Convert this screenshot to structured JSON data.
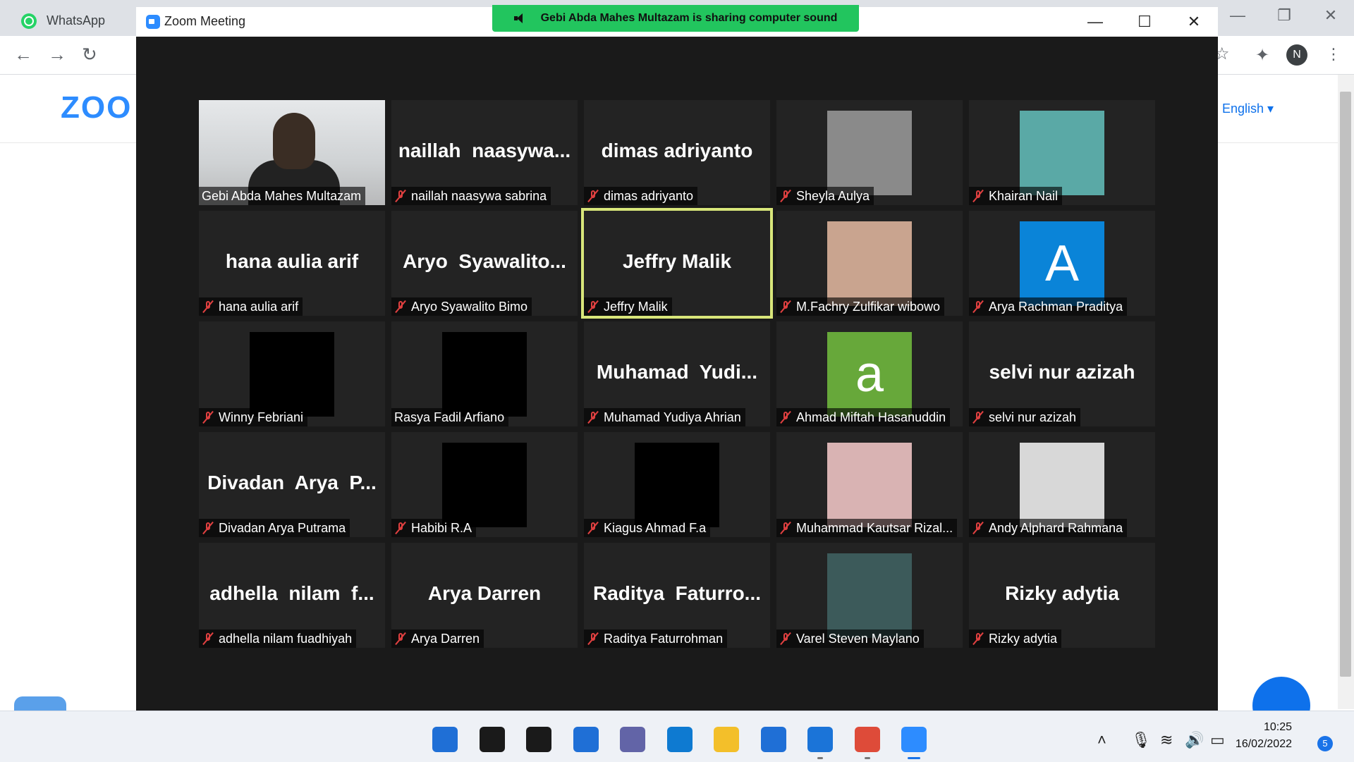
{
  "browser": {
    "tab_title": "WhatsApp",
    "profile_initial": "N",
    "page_logo": "ZOO",
    "language_link": "English ▾"
  },
  "zoom": {
    "window_title": "Zoom Meeting",
    "share_banner": "Gebi Abda Mahes Multazam is sharing computer sound",
    "controls": {
      "minimize": "—",
      "maximize": "☐",
      "close": "✕"
    }
  },
  "participants": [
    {
      "name": "Gebi Abda Mahes Multazam",
      "tile_text": "",
      "kind": "video",
      "muted": false
    },
    {
      "name": "naillah naasywa sabrina",
      "tile_text": "naillah  naasywa...",
      "kind": "text",
      "muted": true
    },
    {
      "name": "dimas adriyanto",
      "tile_text": "dimas adriyanto",
      "kind": "text",
      "muted": true
    },
    {
      "name": "Sheyla Aulya",
      "tile_text": "",
      "kind": "picture",
      "color": "#8a8a8a",
      "muted": true
    },
    {
      "name": "Khairan Nail",
      "tile_text": "",
      "kind": "picture",
      "color": "#5aa9a6",
      "muted": true
    },
    {
      "name": "hana aulia arif",
      "tile_text": "hana aulia arif",
      "kind": "text",
      "muted": true
    },
    {
      "name": "Aryo Syawalito Bimo",
      "tile_text": "Aryo  Syawalito...",
      "kind": "text",
      "muted": true
    },
    {
      "name": "Jeffry Malik",
      "tile_text": "Jeffry Malik",
      "kind": "text",
      "muted": true,
      "active": true
    },
    {
      "name": "M.Fachry Zulfikar wibowo",
      "tile_text": "",
      "kind": "picture",
      "color": "#c9a48f",
      "muted": true
    },
    {
      "name": "Arya Rachman Praditya",
      "tile_text": "A",
      "kind": "letter",
      "color": "#0a84d8",
      "muted": true
    },
    {
      "name": "Winny Febriani",
      "tile_text": "",
      "kind": "picture",
      "color": "#000000",
      "muted": true
    },
    {
      "name": "Rasya Fadil Arfiano",
      "tile_text": "",
      "kind": "picture",
      "color": "#000000",
      "muted": false
    },
    {
      "name": "Muhamad Yudiya Ahrian",
      "tile_text": "Muhamad  Yudi...",
      "kind": "text",
      "muted": true
    },
    {
      "name": "Ahmad Miftah Hasanuddin",
      "tile_text": "a",
      "kind": "letter",
      "color": "#67a83a",
      "muted": true
    },
    {
      "name": "selvi nur azizah",
      "tile_text": "selvi nur azizah",
      "kind": "text",
      "muted": true
    },
    {
      "name": "Divadan Arya Putrama",
      "tile_text": "Divadan  Arya  P...",
      "kind": "text",
      "muted": true
    },
    {
      "name": "Habibi R.A",
      "tile_text": "",
      "kind": "picture",
      "color": "#000000",
      "muted": true
    },
    {
      "name": "Kiagus Ahmad F.a",
      "tile_text": "",
      "kind": "picture",
      "color": "#000000",
      "muted": true
    },
    {
      "name": "Muhammad Kautsar Rizal...",
      "tile_text": "",
      "kind": "picture",
      "color": "#d9b3b3",
      "muted": true
    },
    {
      "name": "Andy Alphard Rahmana",
      "tile_text": "",
      "kind": "picture",
      "color": "#d8d8d8",
      "muted": true
    },
    {
      "name": "adhella nilam fuadhiyah",
      "tile_text": "adhella  nilam  f...",
      "kind": "text",
      "muted": true
    },
    {
      "name": "Arya Darren",
      "tile_text": "Arya Darren",
      "kind": "text",
      "muted": true
    },
    {
      "name": "Raditya Faturrohman",
      "tile_text": "Raditya  Faturro...",
      "kind": "text",
      "muted": true
    },
    {
      "name": "Varel Steven Maylano",
      "tile_text": "",
      "kind": "picture",
      "color": "#3c5a5a",
      "muted": true
    },
    {
      "name": "Rizky adytia",
      "tile_text": "Rizky adytia",
      "kind": "text",
      "muted": true
    }
  ],
  "taskbar": {
    "time": "10:25",
    "date": "16/02/2022",
    "notification_count": "5",
    "apps": [
      {
        "name": "start-icon",
        "color": "#1f6fd6"
      },
      {
        "name": "search-icon",
        "color": "#1a1a1a"
      },
      {
        "name": "task-view-icon",
        "color": "#1a1a1a"
      },
      {
        "name": "widgets-icon",
        "color": "#1f6fd6"
      },
      {
        "name": "teams-chat-icon",
        "color": "#6264a7"
      },
      {
        "name": "edge-icon",
        "color": "#0e7ad1"
      },
      {
        "name": "file-explorer-icon",
        "color": "#f3bf2a"
      },
      {
        "name": "mail-icon",
        "color": "#1f6fd6"
      },
      {
        "name": "app-icon",
        "color": "#1b74d8"
      },
      {
        "name": "chrome-icon",
        "color": "#de4b39"
      },
      {
        "name": "zoom-icon",
        "color": "#2d8cff"
      }
    ]
  }
}
